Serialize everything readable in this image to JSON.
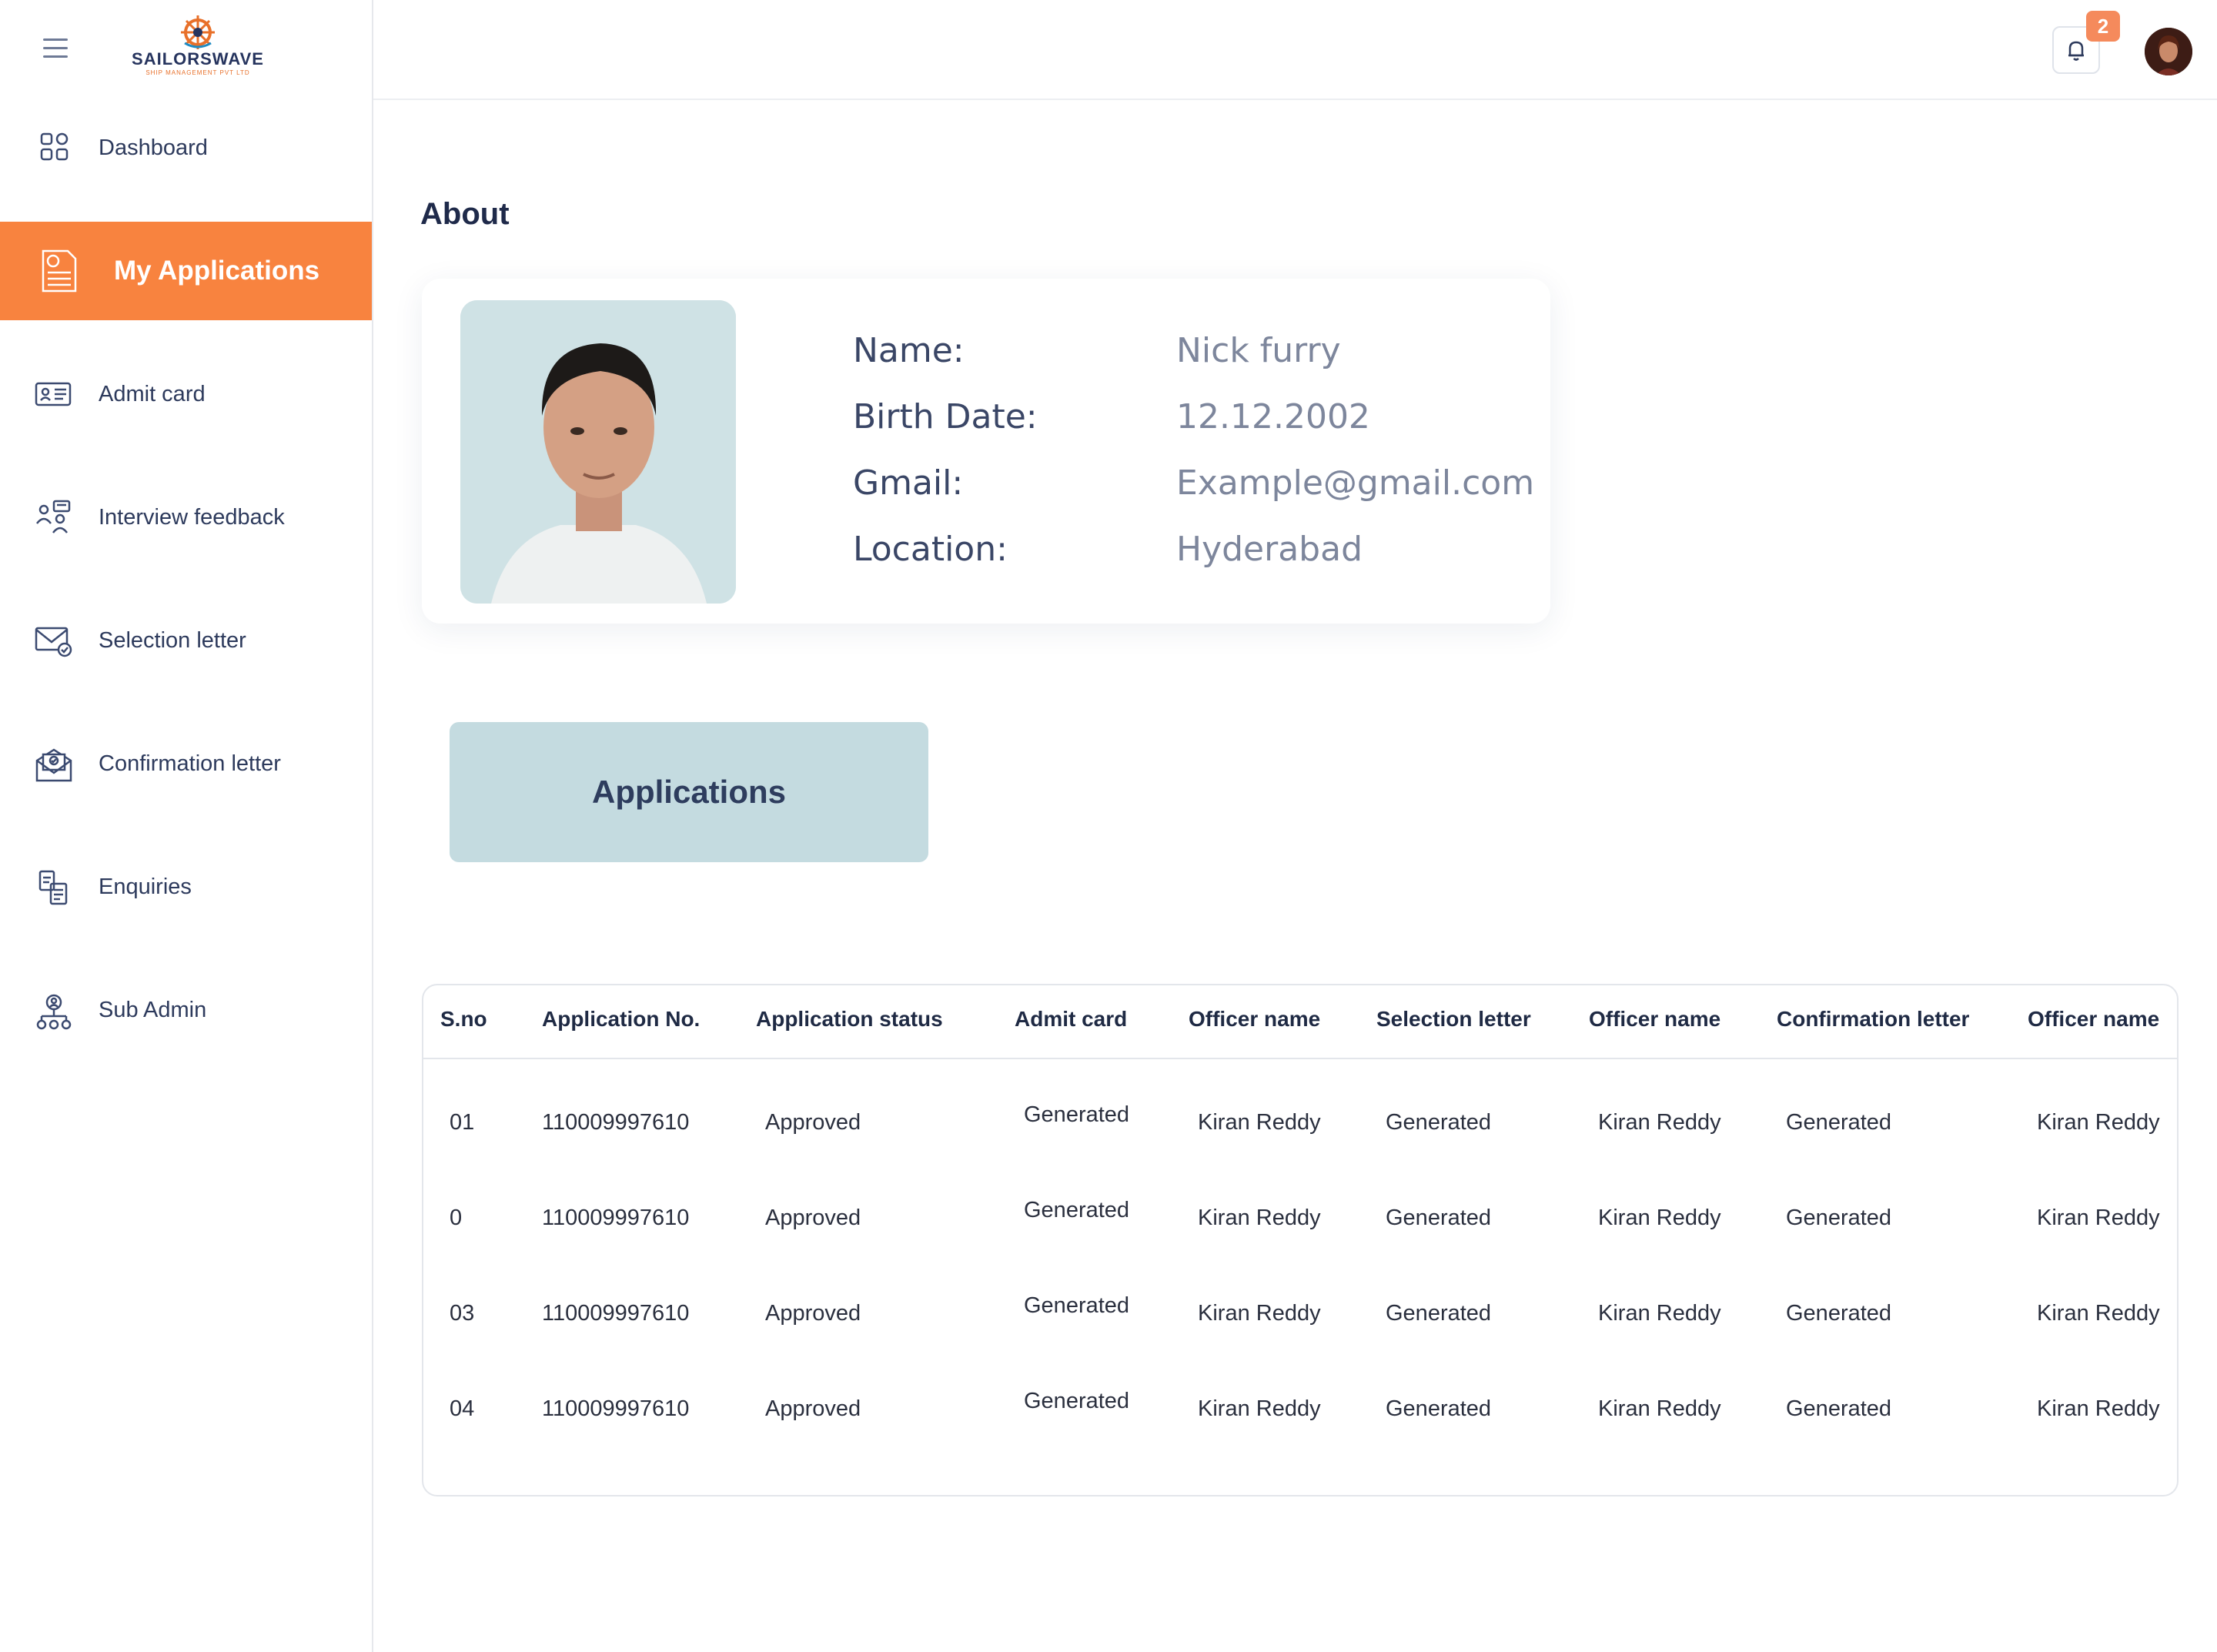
{
  "brand": {
    "name": "SAILORSWAVE",
    "tagline": "SHIP MANAGEMENT PVT LTD"
  },
  "sidebar": {
    "items": [
      {
        "label": "Dashboard",
        "icon": "grid-icon"
      },
      {
        "label": "My Applications",
        "icon": "application-form-icon",
        "active": true
      },
      {
        "label": "Admit card",
        "icon": "id-card-icon"
      },
      {
        "label": "Interview feedback",
        "icon": "interview-icon"
      },
      {
        "label": "Selection letter",
        "icon": "mail-check-icon"
      },
      {
        "label": "Confirmation letter",
        "icon": "open-letter-icon"
      },
      {
        "label": "Enquiries",
        "icon": "enquiry-docs-icon"
      },
      {
        "label": "Sub Admin",
        "icon": "team-hierarchy-icon"
      }
    ]
  },
  "header": {
    "notification_count": "2"
  },
  "about": {
    "title": "About",
    "fields": [
      {
        "label": "Name:",
        "value": "Nick furry"
      },
      {
        "label": "Birth Date:",
        "value": "12.12.2002"
      },
      {
        "label": "Gmail:",
        "value": "Example@gmail.com"
      },
      {
        "label": "Location:",
        "value": "Hyderabad"
      }
    ]
  },
  "applications_button": "Applications",
  "table": {
    "columns": [
      "S.no",
      "Application No.",
      "Application status",
      "Admit card",
      "Officer name",
      "Selection letter",
      "Officer name",
      "Confirmation letter",
      "Officer name"
    ],
    "rows": [
      [
        "01",
        "110009997610",
        "Approved",
        "Generated",
        "Kiran Reddy",
        "Generated",
        "Kiran Reddy",
        "Generated",
        "Kiran Reddy"
      ],
      [
        "0",
        "110009997610",
        "Approved",
        "Generated",
        "Kiran Reddy",
        "Generated",
        "Kiran Reddy",
        "Generated",
        "Kiran Reddy"
      ],
      [
        "03",
        "110009997610",
        "Approved",
        "Generated",
        "Kiran Reddy",
        "Generated",
        "Kiran Reddy",
        "Generated",
        "Kiran Reddy"
      ],
      [
        "04",
        "110009997610",
        "Approved",
        "Generated",
        "Kiran Reddy",
        "Generated",
        "Kiran Reddy",
        "Generated",
        "Kiran Reddy"
      ]
    ]
  },
  "colors": {
    "accent": "#f8833f",
    "button_bg": "#c4dbe0",
    "text_dark": "#1f2a4a",
    "text_muted": "#7d869c"
  }
}
